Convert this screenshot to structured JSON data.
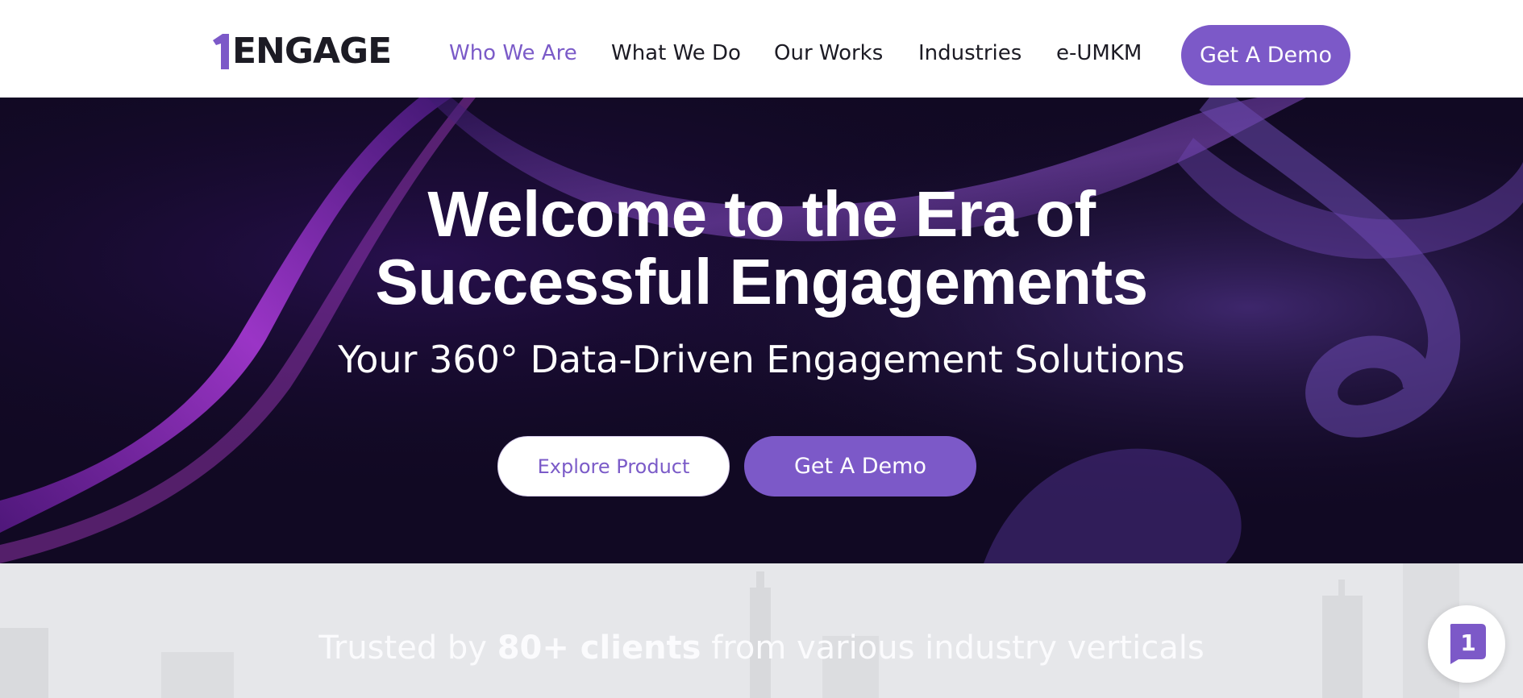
{
  "brand": {
    "logo_text": "ENGAGE",
    "logo_mark": "1",
    "accent": "#7c59c8"
  },
  "nav": {
    "items": [
      {
        "label": "Who We Are",
        "active": true
      },
      {
        "label": "What We Do",
        "active": false
      },
      {
        "label": "Our Works",
        "active": false
      },
      {
        "label": "Industries",
        "active": false
      },
      {
        "label": "e-UMKM",
        "active": false
      }
    ],
    "cta_label": "Get A Demo"
  },
  "hero": {
    "title_line1": "Welcome to the Era of",
    "title_line2": "Successful Engagements",
    "subtitle": "Your 360° Data-Driven Engagement Solutions",
    "explore_label": "Explore Product",
    "demo_label": "Get A Demo"
  },
  "clients": {
    "prefix": "Trusted by ",
    "highlight": "80+ clients",
    "suffix": " from various industry verticals"
  },
  "chat": {
    "icon": "chat-bubble-icon",
    "badge": "1"
  }
}
